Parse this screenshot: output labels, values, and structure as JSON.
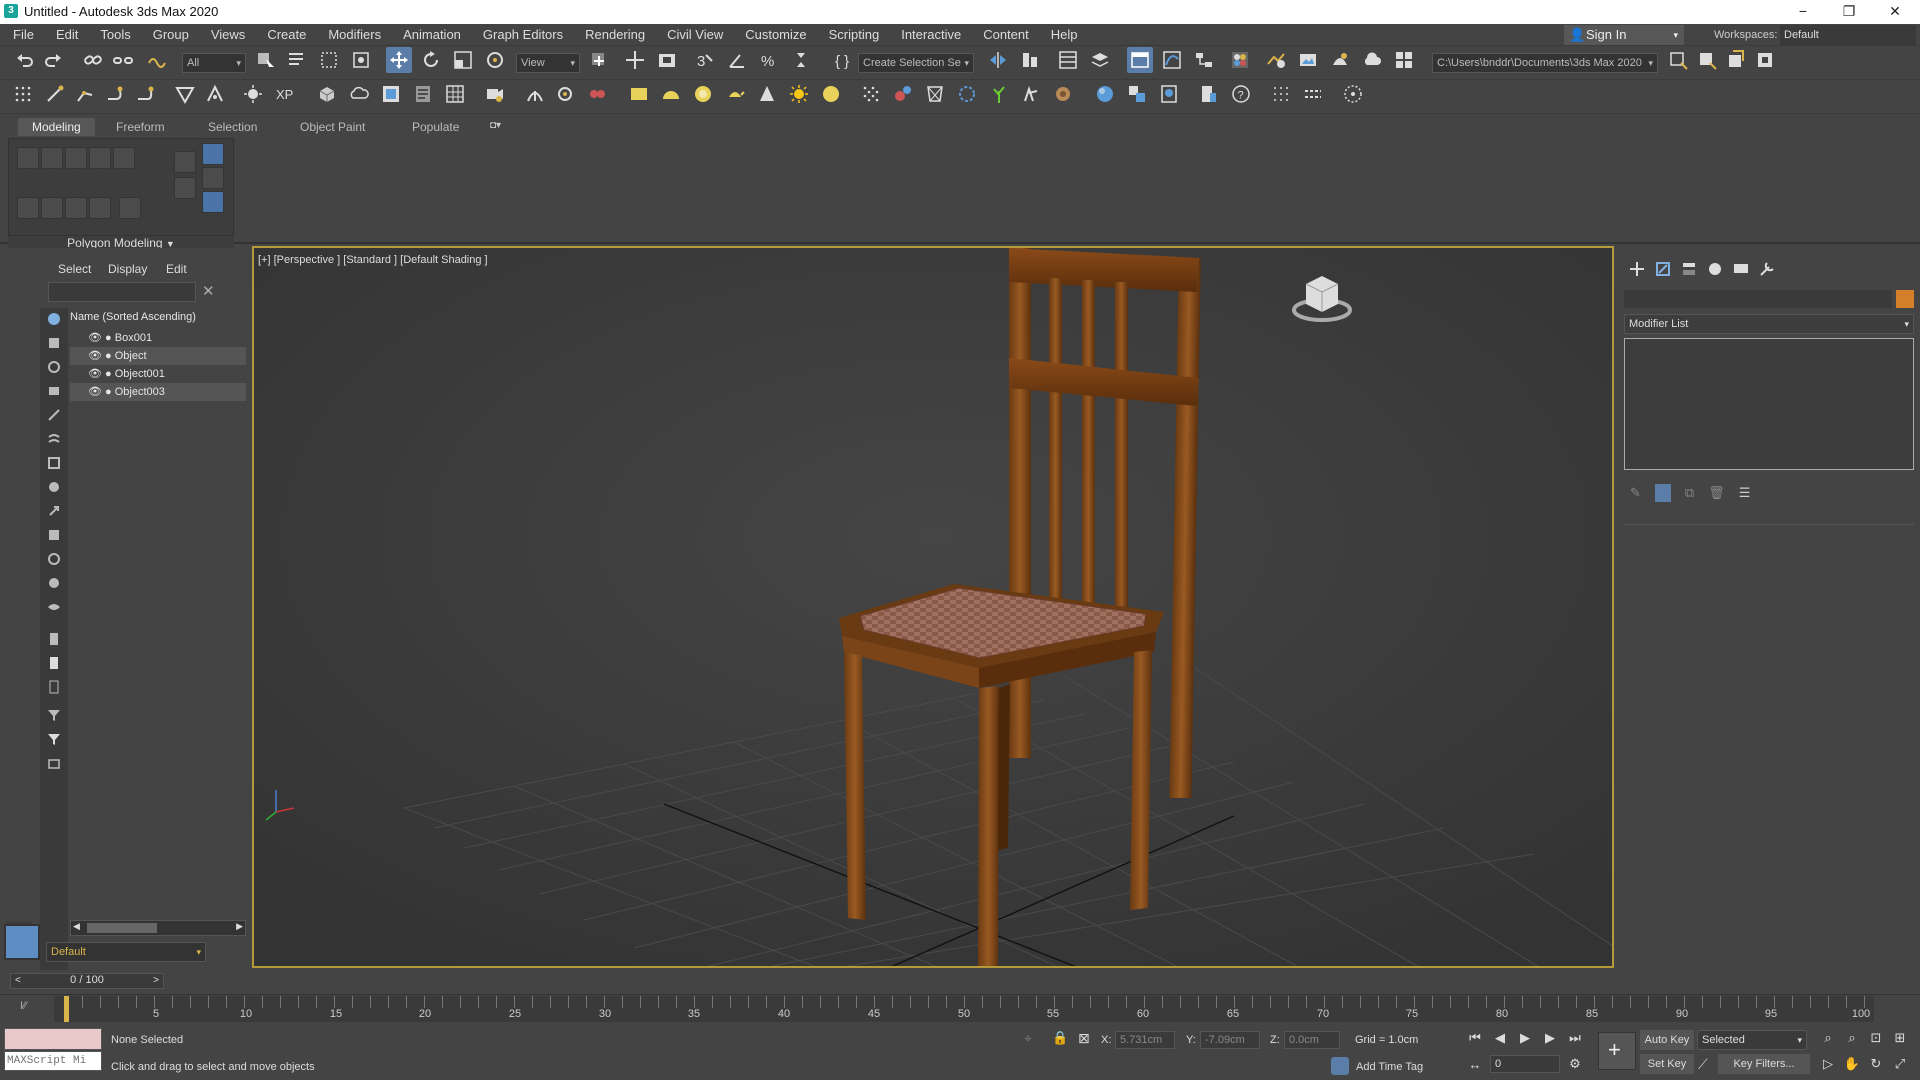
{
  "window": {
    "title": "Untitled - Autodesk 3ds Max 2020",
    "minimize": "−",
    "maximize": "❐",
    "close": "✕"
  },
  "menu": [
    "File",
    "Edit",
    "Tools",
    "Group",
    "Views",
    "Create",
    "Modifiers",
    "Animation",
    "Graph Editors",
    "Rendering",
    "Civil View",
    "Customize",
    "Scripting",
    "Interactive",
    "Content",
    "Help"
  ],
  "account": {
    "sign_in": "Sign In",
    "workspaces_label": "Workspaces:",
    "workspace": "Default"
  },
  "toolbar": {
    "selection_filter": "All",
    "ref_coord": "View",
    "named_selection": "Create Selection Se",
    "project_path": "C:\\Users\\bnddr\\Documents\\3ds Max 2020"
  },
  "ribbon": {
    "tabs": [
      "Modeling",
      "Freeform",
      "Selection",
      "Object Paint",
      "Populate"
    ],
    "panel_label": "Polygon Modeling"
  },
  "explorer": {
    "tabs": [
      "Select",
      "Display",
      "Edit"
    ],
    "header": "Name (Sorted Ascending)",
    "objects": [
      "Box001",
      "Object",
      "Object001",
      "Object003"
    ],
    "layer": "Default"
  },
  "viewport": {
    "label": "[+] [Perspective ] [Standard ] [Default Shading ]"
  },
  "command_panel": {
    "modifier_list": "Modifier List",
    "name_color": "#d4802a"
  },
  "timeline": {
    "frame_display": "0 / 100",
    "ticks": [
      "5",
      "10",
      "15",
      "20",
      "25",
      "30",
      "35",
      "40",
      "45",
      "50",
      "55",
      "60",
      "65",
      "70",
      "75",
      "80",
      "85",
      "90",
      "95",
      "100"
    ]
  },
  "status": {
    "script_placeholder": "MAXScript Mi",
    "selection": "None Selected",
    "prompt": "Click and drag to select and move objects",
    "x_label": "X:",
    "x_value": "5.731cm",
    "y_label": "Y:",
    "y_value": "-7.09cm",
    "z_label": "Z:",
    "z_value": "0.0cm",
    "grid": "Grid = 1.0cm",
    "add_time_tag": "Add Time Tag",
    "auto_key": "Auto Key",
    "set_key": "Set Key",
    "key_mode": "Selected",
    "key_filters": "Key Filters...",
    "current_frame": "0"
  }
}
